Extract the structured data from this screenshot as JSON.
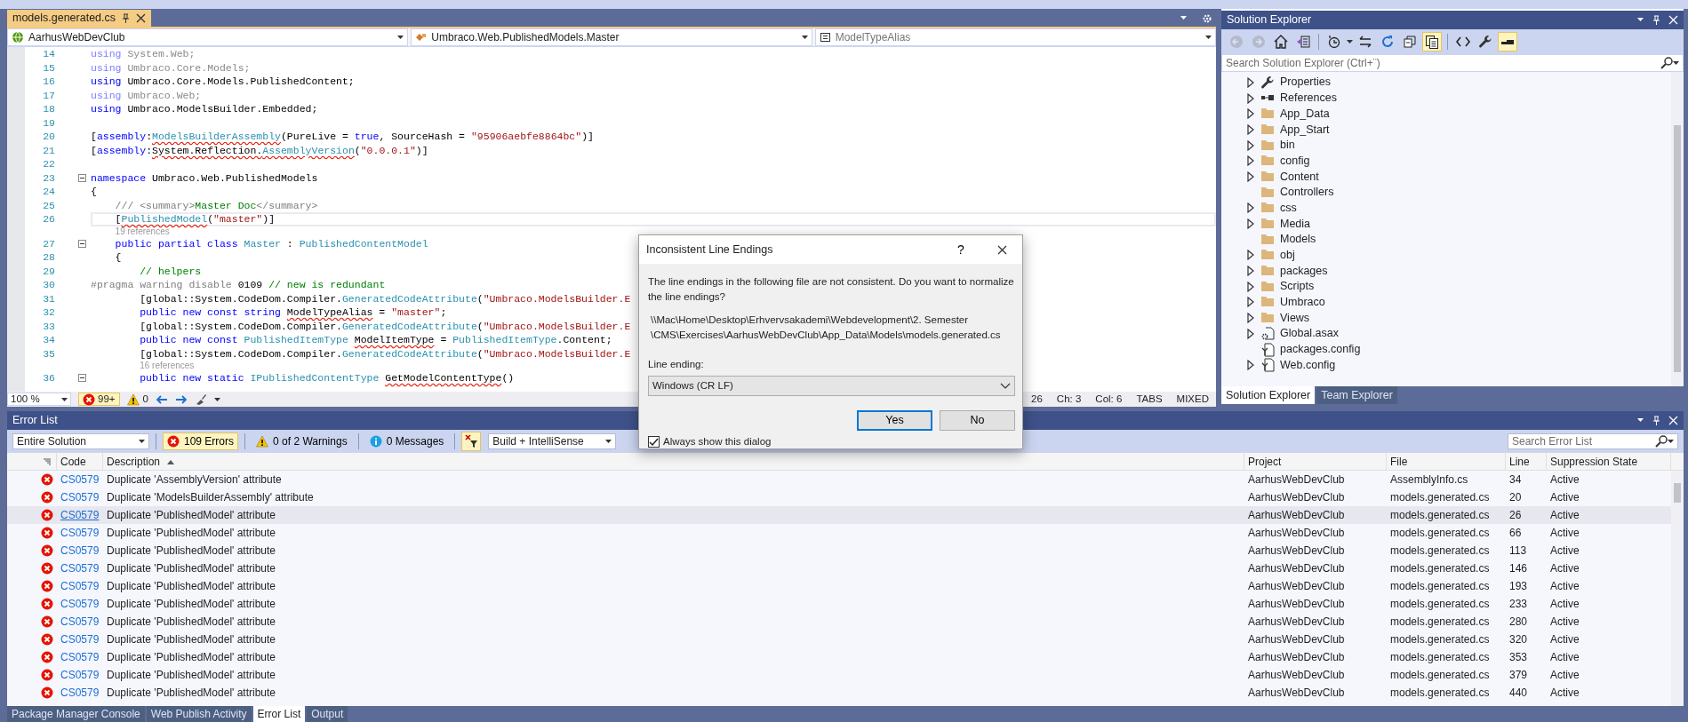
{
  "editor": {
    "tab": {
      "title": "models.generated.cs",
      "selected": true
    },
    "navigation": [
      {
        "kind": "project",
        "text": "AarhusWebDevClub"
      },
      {
        "kind": "class",
        "text": "Umbraco.Web.PublishedModels.Master"
      },
      {
        "kind": "member",
        "text": "ModelTypeAlias"
      }
    ],
    "lines": [
      {
        "kind": "code",
        "number": "14",
        "current": false,
        "fold": false,
        "tokens": [
          {
            "text": "using",
            "kind": "fadedkeyword"
          },
          {
            "text": " System.Web;",
            "kind": "faded"
          }
        ]
      },
      {
        "kind": "code",
        "number": "15",
        "current": false,
        "fold": false,
        "tokens": [
          {
            "text": "using",
            "kind": "fadedkeyword"
          },
          {
            "text": " Umbraco.Core.Models;",
            "kind": "faded"
          }
        ]
      },
      {
        "kind": "code",
        "number": "16",
        "current": false,
        "fold": false,
        "tokens": [
          {
            "text": "using",
            "kind": "keyword"
          },
          {
            "text": " Umbraco.Core.Models.PublishedContent;",
            "kind": "text"
          }
        ]
      },
      {
        "kind": "code",
        "number": "17",
        "current": false,
        "fold": false,
        "tokens": [
          {
            "text": "using",
            "kind": "fadedkeyword"
          },
          {
            "text": " Umbraco.Web;",
            "kind": "faded"
          }
        ]
      },
      {
        "kind": "code",
        "number": "18",
        "current": false,
        "fold": false,
        "tokens": [
          {
            "text": "using",
            "kind": "keyword"
          },
          {
            "text": " Umbraco.ModelsBuilder.Embedded;",
            "kind": "text"
          }
        ]
      },
      {
        "kind": "code",
        "number": "19",
        "current": false,
        "fold": false
      },
      {
        "kind": "code",
        "number": "20",
        "current": false,
        "fold": false,
        "tokens": [
          {
            "text": "[",
            "kind": "text"
          },
          {
            "text": "assembly",
            "kind": "keyword"
          },
          {
            "text": ":",
            "kind": "text"
          },
          {
            "text": "ModelsBuilderAssembly",
            "kind": "typeerror"
          },
          {
            "text": "(PureLive = ",
            "kind": "text"
          },
          {
            "text": "true",
            "kind": "keyword"
          },
          {
            "text": ", SourceHash = ",
            "kind": "text"
          },
          {
            "text": "\"95906aebfe8864bc\"",
            "kind": "string"
          },
          {
            "text": ")]",
            "kind": "text"
          }
        ]
      },
      {
        "kind": "code",
        "number": "21",
        "current": false,
        "fold": false,
        "tokens": [
          {
            "text": "[",
            "kind": "text"
          },
          {
            "text": "assembly",
            "kind": "keyword"
          },
          {
            "text": ":",
            "kind": "text"
          },
          {
            "text": "System.Reflection.",
            "kind": "texterror"
          },
          {
            "text": "AssemblyVersion",
            "kind": "typeerror"
          },
          {
            "text": "(",
            "kind": "text"
          },
          {
            "text": "\"0.0.0.1\"",
            "kind": "string"
          },
          {
            "text": ")]",
            "kind": "text"
          }
        ]
      },
      {
        "kind": "code",
        "number": "22",
        "current": false,
        "fold": false
      },
      {
        "kind": "code",
        "number": "23",
        "current": false,
        "fold": true,
        "tokens": [
          {
            "text": "namespace",
            "kind": "keyword"
          },
          {
            "text": " Umbraco.Web.PublishedModels",
            "kind": "text"
          }
        ]
      },
      {
        "kind": "code",
        "number": "24",
        "current": false,
        "fold": false,
        "tokens": [
          {
            "text": "{",
            "kind": "text"
          }
        ]
      },
      {
        "kind": "code",
        "number": "25",
        "current": false,
        "fold": false,
        "tokens": [
          {
            "text": "    /// <summary>",
            "kind": "doc"
          },
          {
            "text": "Master Doc",
            "kind": "comment"
          },
          {
            "text": "</summary>",
            "kind": "doc"
          }
        ]
      },
      {
        "kind": "code",
        "number": "26",
        "current": true,
        "fold": false,
        "tokens": [
          {
            "text": "    [",
            "kind": "text"
          },
          {
            "text": "PublishedModel",
            "kind": "typeerror"
          },
          {
            "text": "(",
            "kind": "text"
          },
          {
            "text": "\"master\"",
            "kind": "string"
          },
          {
            "text": ")]",
            "kind": "text"
          }
        ]
      },
      {
        "kind": "codelens",
        "text": "19 references"
      },
      {
        "kind": "code",
        "number": "27",
        "current": false,
        "fold": true,
        "tokens": [
          {
            "text": "    public partial class",
            "kind": "keyword"
          },
          {
            "text": " Master",
            "kind": "type"
          },
          {
            "text": " : ",
            "kind": "text"
          },
          {
            "text": "PublishedContentModel",
            "kind": "type"
          }
        ]
      },
      {
        "kind": "code",
        "number": "28",
        "current": false,
        "fold": false,
        "tokens": [
          {
            "text": "    {",
            "kind": "text"
          }
        ]
      },
      {
        "kind": "code",
        "number": "29",
        "current": false,
        "fold": false,
        "tokens": [
          {
            "text": "        // helpers",
            "kind": "comment"
          }
        ]
      },
      {
        "kind": "code",
        "number": "30",
        "current": false,
        "fold": false,
        "tokens": [
          {
            "text": "#pragma warning disable",
            "kind": "doc"
          },
          {
            "text": " 0109 ",
            "kind": "text"
          },
          {
            "text": "// new is redundant",
            "kind": "comment"
          }
        ]
      },
      {
        "kind": "code",
        "number": "31",
        "current": false,
        "fold": false,
        "tokens": [
          {
            "text": "        [global::System.CodeDom.Compiler.",
            "kind": "text"
          },
          {
            "text": "GeneratedCodeAttribute",
            "kind": "type"
          },
          {
            "text": "(",
            "kind": "text"
          },
          {
            "text": "\"Umbraco.ModelsBuilder.E",
            "kind": "string"
          }
        ]
      },
      {
        "kind": "code",
        "number": "32",
        "current": false,
        "fold": false,
        "tokens": [
          {
            "text": "        public new const string ",
            "kind": "keyword"
          },
          {
            "text": "ModelTypeAlias",
            "kind": "texterror"
          },
          {
            "text": " = ",
            "kind": "text"
          },
          {
            "text": "\"master\"",
            "kind": "string"
          },
          {
            "text": ";",
            "kind": "text"
          }
        ]
      },
      {
        "kind": "code",
        "number": "33",
        "current": false,
        "fold": false,
        "tokens": [
          {
            "text": "        [global::System.CodeDom.Compiler.",
            "kind": "text"
          },
          {
            "text": "GeneratedCodeAttribute",
            "kind": "type"
          },
          {
            "text": "(",
            "kind": "text"
          },
          {
            "text": "\"Umbraco.ModelsBuilder.E",
            "kind": "string"
          }
        ]
      },
      {
        "kind": "code",
        "number": "34",
        "current": false,
        "fold": false,
        "tokens": [
          {
            "text": "        public new const ",
            "kind": "keyword"
          },
          {
            "text": "PublishedItemType ",
            "kind": "type"
          },
          {
            "text": "ModelItemType",
            "kind": "texterror"
          },
          {
            "text": " = ",
            "kind": "text"
          },
          {
            "text": "PublishedItemType",
            "kind": "type"
          },
          {
            "text": ".Content;",
            "kind": "text"
          }
        ]
      },
      {
        "kind": "code",
        "number": "35",
        "current": false,
        "fold": false,
        "tokens": [
          {
            "text": "        [global::System.CodeDom.Compiler.",
            "kind": "text"
          },
          {
            "text": "GeneratedCodeAttribute",
            "kind": "type"
          },
          {
            "text": "(",
            "kind": "text"
          },
          {
            "text": "\"Umbraco.ModelsBuilder.E",
            "kind": "string"
          }
        ]
      },
      {
        "kind": "codelens",
        "text": "16 references"
      },
      {
        "kind": "code",
        "number": "36",
        "current": false,
        "fold": true,
        "tokens": [
          {
            "text": "        public new static ",
            "kind": "keyword"
          },
          {
            "text": "IPublishedContentType ",
            "kind": "type"
          },
          {
            "text": "GetModelContentType",
            "kind": "texterror"
          },
          {
            "text": "()",
            "kind": "text"
          }
        ]
      }
    ],
    "status": {
      "zoom": "100 %",
      "errors": "99+",
      "warnings": "0",
      "line": "26",
      "char": "Ch: 3",
      "column": "Col: 6",
      "indent": "TABS",
      "line_endings": "MIXED"
    }
  },
  "solution_explorer": {
    "title": "Solution Explorer",
    "toolbar": [
      {
        "kind": "back",
        "on": false,
        "disabled": true
      },
      {
        "kind": "forward",
        "on": false,
        "disabled": true
      },
      {
        "kind": "home",
        "on": false,
        "disabled": false
      },
      {
        "kind": "views",
        "on": false,
        "disabled": false
      },
      {
        "kind": "history",
        "on": false,
        "disabled": false
      },
      {
        "kind": "sync",
        "on": false,
        "disabled": false
      },
      {
        "kind": "refresh",
        "on": false,
        "disabled": false
      },
      {
        "kind": "collapse",
        "on": false,
        "disabled": false
      },
      {
        "kind": "showall",
        "on": true,
        "disabled": false
      },
      {
        "kind": "code",
        "on": false,
        "disabled": false
      },
      {
        "kind": "properties",
        "on": false,
        "disabled": false
      },
      {
        "kind": "preview",
        "on": true,
        "disabled": false
      }
    ],
    "search": {
      "placeholder": "Search Solution Explorer (Ctrl+¨)"
    },
    "items": [
      {
        "label": "Properties",
        "kind": "wrench",
        "expandable": true
      },
      {
        "label": "References",
        "kind": "references",
        "expandable": true
      },
      {
        "label": "App_Data",
        "kind": "folder",
        "expandable": true
      },
      {
        "label": "App_Start",
        "kind": "folder",
        "expandable": true
      },
      {
        "label": "bin",
        "kind": "folder",
        "expandable": true
      },
      {
        "label": "config",
        "kind": "folder",
        "expandable": true
      },
      {
        "label": "Content",
        "kind": "folder",
        "expandable": true
      },
      {
        "label": "Controllers",
        "kind": "folder",
        "expandable": false
      },
      {
        "label": "css",
        "kind": "folder",
        "expandable": true
      },
      {
        "label": "Media",
        "kind": "folder",
        "expandable": true
      },
      {
        "label": "Models",
        "kind": "folder",
        "expandable": false
      },
      {
        "label": "obj",
        "kind": "folder",
        "expandable": true
      },
      {
        "label": "packages",
        "kind": "folder",
        "expandable": true
      },
      {
        "label": "Scripts",
        "kind": "folder",
        "expandable": true
      },
      {
        "label": "Umbraco",
        "kind": "folder",
        "expandable": true
      },
      {
        "label": "Views",
        "kind": "folder",
        "expandable": true
      },
      {
        "label": "Global.asax",
        "kind": "gearfile",
        "expandable": true
      },
      {
        "label": "packages.config",
        "kind": "configfile",
        "expandable": false
      },
      {
        "label": "Web.config",
        "kind": "configfile",
        "expandable": true
      }
    ],
    "tabs": [
      {
        "label": "Solution Explorer",
        "selected": true
      },
      {
        "label": "Team Explorer",
        "selected": false
      }
    ]
  },
  "error_list": {
    "title": "Error List",
    "scope": "Entire Solution",
    "filters": [
      {
        "kind": "errors",
        "label": "109 Errors",
        "selected": true
      },
      {
        "kind": "warnings",
        "label": "0 of 2 Warnings",
        "selected": false
      },
      {
        "kind": "messages",
        "label": "0 Messages",
        "selected": false
      }
    ],
    "filter_toggle": {
      "on": true
    },
    "source": "Build + IntelliSense",
    "search": {
      "placeholder": "Search Error List"
    },
    "columns": [
      "Code",
      "Description",
      "Project",
      "File",
      "Line",
      "Suppression State"
    ],
    "rows": [
      {
        "code": "CS0579",
        "description": "Duplicate 'AssemblyVersion' attribute",
        "project": "AarhusWebDevClub",
        "file": "AssemblyInfo.cs",
        "line": "34",
        "state": "Active",
        "selected": false
      },
      {
        "code": "CS0579",
        "description": "Duplicate 'ModelsBuilderAssembly' attribute",
        "project": "AarhusWebDevClub",
        "file": "models.generated.cs",
        "line": "20",
        "state": "Active",
        "selected": false
      },
      {
        "code": "CS0579",
        "description": "Duplicate 'PublishedModel' attribute",
        "project": "AarhusWebDevClub",
        "file": "models.generated.cs",
        "line": "26",
        "state": "Active",
        "selected": true
      },
      {
        "code": "CS0579",
        "description": "Duplicate 'PublishedModel' attribute",
        "project": "AarhusWebDevClub",
        "file": "models.generated.cs",
        "line": "66",
        "state": "Active",
        "selected": false
      },
      {
        "code": "CS0579",
        "description": "Duplicate 'PublishedModel' attribute",
        "project": "AarhusWebDevClub",
        "file": "models.generated.cs",
        "line": "113",
        "state": "Active",
        "selected": false
      },
      {
        "code": "CS0579",
        "description": "Duplicate 'PublishedModel' attribute",
        "project": "AarhusWebDevClub",
        "file": "models.generated.cs",
        "line": "146",
        "state": "Active",
        "selected": false
      },
      {
        "code": "CS0579",
        "description": "Duplicate 'PublishedModel' attribute",
        "project": "AarhusWebDevClub",
        "file": "models.generated.cs",
        "line": "193",
        "state": "Active",
        "selected": false
      },
      {
        "code": "CS0579",
        "description": "Duplicate 'PublishedModel' attribute",
        "project": "AarhusWebDevClub",
        "file": "models.generated.cs",
        "line": "233",
        "state": "Active",
        "selected": false
      },
      {
        "code": "CS0579",
        "description": "Duplicate 'PublishedModel' attribute",
        "project": "AarhusWebDevClub",
        "file": "models.generated.cs",
        "line": "280",
        "state": "Active",
        "selected": false
      },
      {
        "code": "CS0579",
        "description": "Duplicate 'PublishedModel' attribute",
        "project": "AarhusWebDevClub",
        "file": "models.generated.cs",
        "line": "320",
        "state": "Active",
        "selected": false
      },
      {
        "code": "CS0579",
        "description": "Duplicate 'PublishedModel' attribute",
        "project": "AarhusWebDevClub",
        "file": "models.generated.cs",
        "line": "353",
        "state": "Active",
        "selected": false
      },
      {
        "code": "CS0579",
        "description": "Duplicate 'PublishedModel' attribute",
        "project": "AarhusWebDevClub",
        "file": "models.generated.cs",
        "line": "379",
        "state": "Active",
        "selected": false
      },
      {
        "code": "CS0579",
        "description": "Duplicate 'PublishedModel' attribute",
        "project": "AarhusWebDevClub",
        "file": "models.generated.cs",
        "line": "440",
        "state": "Active",
        "selected": false
      }
    ]
  },
  "bottom_tabs": [
    {
      "label": "Package Manager Console",
      "selected": false
    },
    {
      "label": "Web Publish Activity",
      "selected": false
    },
    {
      "label": "Error List",
      "selected": true
    },
    {
      "label": "Output",
      "selected": false
    }
  ],
  "dialog": {
    "title": "Inconsistent Line Endings",
    "help": "?",
    "message": "The line endings in the following file are not consistent. Do you want to normalize the line endings?",
    "path_lines": [
      "\\\\Mac\\Home\\Desktop\\Erhvervsakademi\\Webdevelopment\\2. Semester",
      "\\CMS\\Exercises\\AarhusWebDevClub\\App_Data\\Models\\models.generated.cs"
    ],
    "line_ending_label": "Line ending:",
    "line_ending": "Windows (CR LF)",
    "buttons": [
      {
        "label": "Yes",
        "default": true
      },
      {
        "label": "No",
        "default": false
      }
    ],
    "always_show": {
      "label": "Always show this dialog",
      "checked": true
    }
  }
}
